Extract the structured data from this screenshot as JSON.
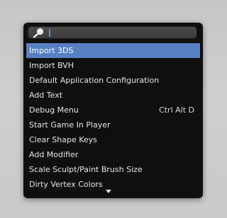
{
  "search": {
    "value": "",
    "icon": "search-icon"
  },
  "menu": {
    "items": [
      {
        "label": "Import 3DS",
        "shortcut": "",
        "active": true
      },
      {
        "label": "Import BVH",
        "shortcut": ""
      },
      {
        "label": "Default Application Configuration",
        "shortcut": ""
      },
      {
        "label": "Add Text",
        "shortcut": ""
      },
      {
        "label": "Debug Menu",
        "shortcut": "Ctrl Alt D"
      },
      {
        "label": "Start Game In Player",
        "shortcut": ""
      },
      {
        "label": "Clear Shape Keys",
        "shortcut": ""
      },
      {
        "label": "Add Modifier",
        "shortcut": ""
      },
      {
        "label": "Scale Sculpt/Paint Brush Size",
        "shortcut": ""
      },
      {
        "label": "Dirty Vertex Colors",
        "shortcut": ""
      }
    ],
    "scroll_icon": "chevron-down-icon"
  },
  "colors": {
    "highlight": "#5680c2",
    "panel_bg": "#0f0f0f",
    "text": "#e6e6e6"
  }
}
